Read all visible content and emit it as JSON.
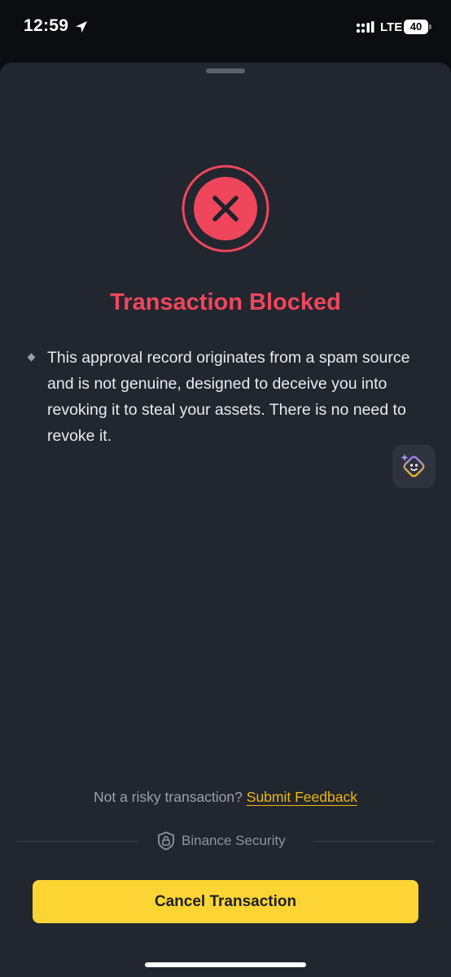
{
  "status_bar": {
    "time": "12:59",
    "network": "LTE",
    "battery": "40"
  },
  "alert": {
    "title": "Transaction Blocked",
    "message": "This approval record originates from a spam source and is not genuine, designed to deceive you into revoking it to steal your assets. There is no need to revoke it.",
    "icon": "x-circle-icon"
  },
  "feedback": {
    "prompt": "Not a risky transaction?",
    "link": "Submit Feedback"
  },
  "footer": {
    "security_label": "Binance Security",
    "cancel_label": "Cancel Transaction"
  },
  "colors": {
    "danger": "#f0465b",
    "accent": "#fcd535",
    "link": "#f0b90b",
    "sheet_background": "#22262f"
  }
}
